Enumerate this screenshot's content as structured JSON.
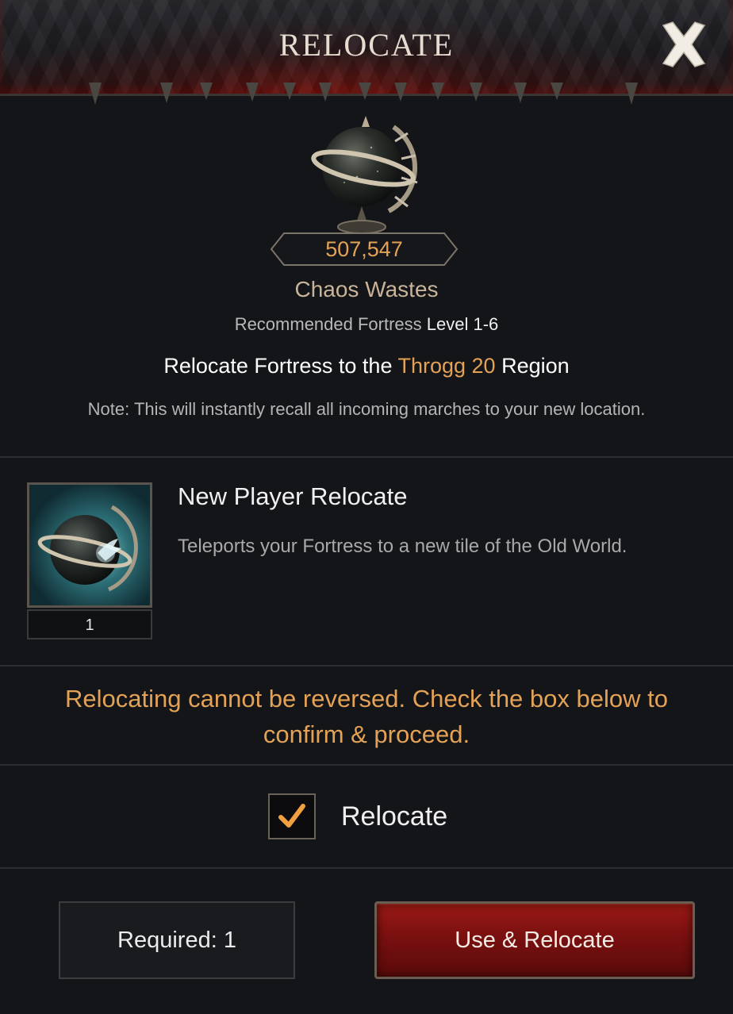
{
  "header": {
    "title": "RELOCATE"
  },
  "globe": {
    "cost": "507,547",
    "region_type": "Chaos Wastes"
  },
  "recommend": {
    "prefix": "Recommended Fortress ",
    "level": "Level 1-6"
  },
  "relocate_line": {
    "prefix": "Relocate Fortress to the ",
    "region": "Throgg 20",
    "suffix": " Region"
  },
  "note": "Note: This will instantly recall all incoming marches to your new location.",
  "item": {
    "title": "New Player Relocate",
    "description": "Teleports your Fortress to a new tile of the Old World.",
    "count": "1"
  },
  "warning": "Relocating cannot be reversed. Check the box below to confirm & proceed.",
  "confirm": {
    "label": "Relocate",
    "checked": true
  },
  "buttons": {
    "required": "Required: 1",
    "use": "Use & Relocate"
  },
  "colors": {
    "accent": "#e4a256",
    "button_red": "#8a1410",
    "background": "#141518"
  }
}
